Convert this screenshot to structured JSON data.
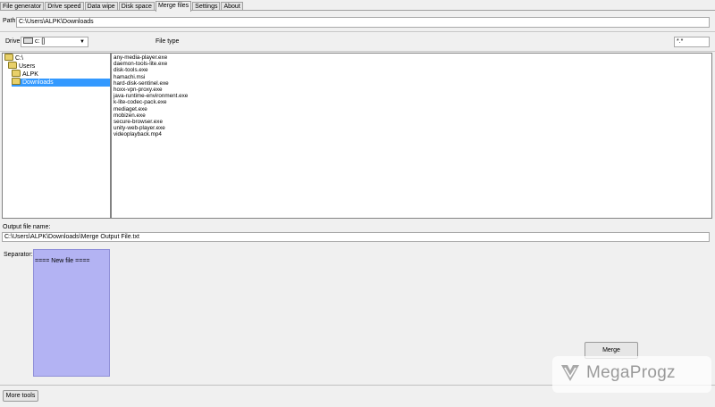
{
  "tabs": [
    {
      "label": "File generator",
      "active": false
    },
    {
      "label": "Drive speed",
      "active": false
    },
    {
      "label": "Data wipe",
      "active": false
    },
    {
      "label": "Disk space",
      "active": false
    },
    {
      "label": "Merge files",
      "active": true
    },
    {
      "label": "Settings",
      "active": false
    },
    {
      "label": "About",
      "active": false
    }
  ],
  "path": {
    "label": "Path:",
    "value": "C:\\Users\\ALPK\\Downloads"
  },
  "drive": {
    "label": "Drive",
    "value": "c: []"
  },
  "file_type": {
    "label": "File type",
    "value": "*.*"
  },
  "tree": [
    {
      "label": "C:\\",
      "selected": false
    },
    {
      "label": "Users",
      "selected": false
    },
    {
      "label": "ALPK",
      "selected": false
    },
    {
      "label": "Downloads",
      "selected": true
    }
  ],
  "files": [
    "any-media-player.exe",
    "daemon-tools-lite.exe",
    "disk-tools.exe",
    "hamachi.msi",
    "hard-disk-sentinel.exe",
    "hoxx-vpn-proxy.exe",
    "java-runtime-environment.exe",
    "k-lite-codec-pack.exe",
    "mediaget.exe",
    "mobizen.exe",
    "secure-browser.exe",
    "unity-web-player.exe",
    "videoplayback.mp4"
  ],
  "output": {
    "label": "Output file name:",
    "value": "C:\\Users\\ALPK\\Downloads\\Merge Output File.txt"
  },
  "separator": {
    "label": "Separator:",
    "value": "==== New file ===="
  },
  "merge_button": "Merge",
  "more_tools_button": "More tools",
  "watermark": {
    "text": "MegaProgz"
  }
}
